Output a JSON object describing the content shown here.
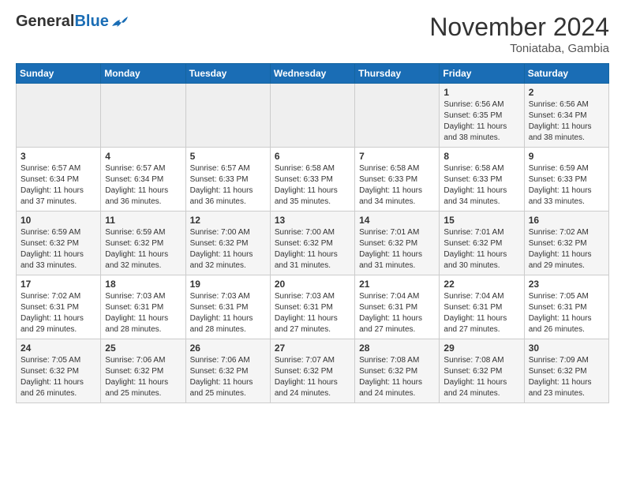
{
  "header": {
    "logo_general": "General",
    "logo_blue": "Blue",
    "month": "November 2024",
    "location": "Toniataba, Gambia"
  },
  "weekdays": [
    "Sunday",
    "Monday",
    "Tuesday",
    "Wednesday",
    "Thursday",
    "Friday",
    "Saturday"
  ],
  "weeks": [
    [
      {
        "day": null,
        "info": null
      },
      {
        "day": null,
        "info": null
      },
      {
        "day": null,
        "info": null
      },
      {
        "day": null,
        "info": null
      },
      {
        "day": null,
        "info": null
      },
      {
        "day": "1",
        "info": "Sunrise: 6:56 AM\nSunset: 6:35 PM\nDaylight: 11 hours and 38 minutes."
      },
      {
        "day": "2",
        "info": "Sunrise: 6:56 AM\nSunset: 6:34 PM\nDaylight: 11 hours and 38 minutes."
      }
    ],
    [
      {
        "day": "3",
        "info": "Sunrise: 6:57 AM\nSunset: 6:34 PM\nDaylight: 11 hours and 37 minutes."
      },
      {
        "day": "4",
        "info": "Sunrise: 6:57 AM\nSunset: 6:34 PM\nDaylight: 11 hours and 36 minutes."
      },
      {
        "day": "5",
        "info": "Sunrise: 6:57 AM\nSunset: 6:33 PM\nDaylight: 11 hours and 36 minutes."
      },
      {
        "day": "6",
        "info": "Sunrise: 6:58 AM\nSunset: 6:33 PM\nDaylight: 11 hours and 35 minutes."
      },
      {
        "day": "7",
        "info": "Sunrise: 6:58 AM\nSunset: 6:33 PM\nDaylight: 11 hours and 34 minutes."
      },
      {
        "day": "8",
        "info": "Sunrise: 6:58 AM\nSunset: 6:33 PM\nDaylight: 11 hours and 34 minutes."
      },
      {
        "day": "9",
        "info": "Sunrise: 6:59 AM\nSunset: 6:33 PM\nDaylight: 11 hours and 33 minutes."
      }
    ],
    [
      {
        "day": "10",
        "info": "Sunrise: 6:59 AM\nSunset: 6:32 PM\nDaylight: 11 hours and 33 minutes."
      },
      {
        "day": "11",
        "info": "Sunrise: 6:59 AM\nSunset: 6:32 PM\nDaylight: 11 hours and 32 minutes."
      },
      {
        "day": "12",
        "info": "Sunrise: 7:00 AM\nSunset: 6:32 PM\nDaylight: 11 hours and 32 minutes."
      },
      {
        "day": "13",
        "info": "Sunrise: 7:00 AM\nSunset: 6:32 PM\nDaylight: 11 hours and 31 minutes."
      },
      {
        "day": "14",
        "info": "Sunrise: 7:01 AM\nSunset: 6:32 PM\nDaylight: 11 hours and 31 minutes."
      },
      {
        "day": "15",
        "info": "Sunrise: 7:01 AM\nSunset: 6:32 PM\nDaylight: 11 hours and 30 minutes."
      },
      {
        "day": "16",
        "info": "Sunrise: 7:02 AM\nSunset: 6:32 PM\nDaylight: 11 hours and 29 minutes."
      }
    ],
    [
      {
        "day": "17",
        "info": "Sunrise: 7:02 AM\nSunset: 6:31 PM\nDaylight: 11 hours and 29 minutes."
      },
      {
        "day": "18",
        "info": "Sunrise: 7:03 AM\nSunset: 6:31 PM\nDaylight: 11 hours and 28 minutes."
      },
      {
        "day": "19",
        "info": "Sunrise: 7:03 AM\nSunset: 6:31 PM\nDaylight: 11 hours and 28 minutes."
      },
      {
        "day": "20",
        "info": "Sunrise: 7:03 AM\nSunset: 6:31 PM\nDaylight: 11 hours and 27 minutes."
      },
      {
        "day": "21",
        "info": "Sunrise: 7:04 AM\nSunset: 6:31 PM\nDaylight: 11 hours and 27 minutes."
      },
      {
        "day": "22",
        "info": "Sunrise: 7:04 AM\nSunset: 6:31 PM\nDaylight: 11 hours and 27 minutes."
      },
      {
        "day": "23",
        "info": "Sunrise: 7:05 AM\nSunset: 6:31 PM\nDaylight: 11 hours and 26 minutes."
      }
    ],
    [
      {
        "day": "24",
        "info": "Sunrise: 7:05 AM\nSunset: 6:32 PM\nDaylight: 11 hours and 26 minutes."
      },
      {
        "day": "25",
        "info": "Sunrise: 7:06 AM\nSunset: 6:32 PM\nDaylight: 11 hours and 25 minutes."
      },
      {
        "day": "26",
        "info": "Sunrise: 7:06 AM\nSunset: 6:32 PM\nDaylight: 11 hours and 25 minutes."
      },
      {
        "day": "27",
        "info": "Sunrise: 7:07 AM\nSunset: 6:32 PM\nDaylight: 11 hours and 24 minutes."
      },
      {
        "day": "28",
        "info": "Sunrise: 7:08 AM\nSunset: 6:32 PM\nDaylight: 11 hours and 24 minutes."
      },
      {
        "day": "29",
        "info": "Sunrise: 7:08 AM\nSunset: 6:32 PM\nDaylight: 11 hours and 24 minutes."
      },
      {
        "day": "30",
        "info": "Sunrise: 7:09 AM\nSunset: 6:32 PM\nDaylight: 11 hours and 23 minutes."
      }
    ]
  ]
}
